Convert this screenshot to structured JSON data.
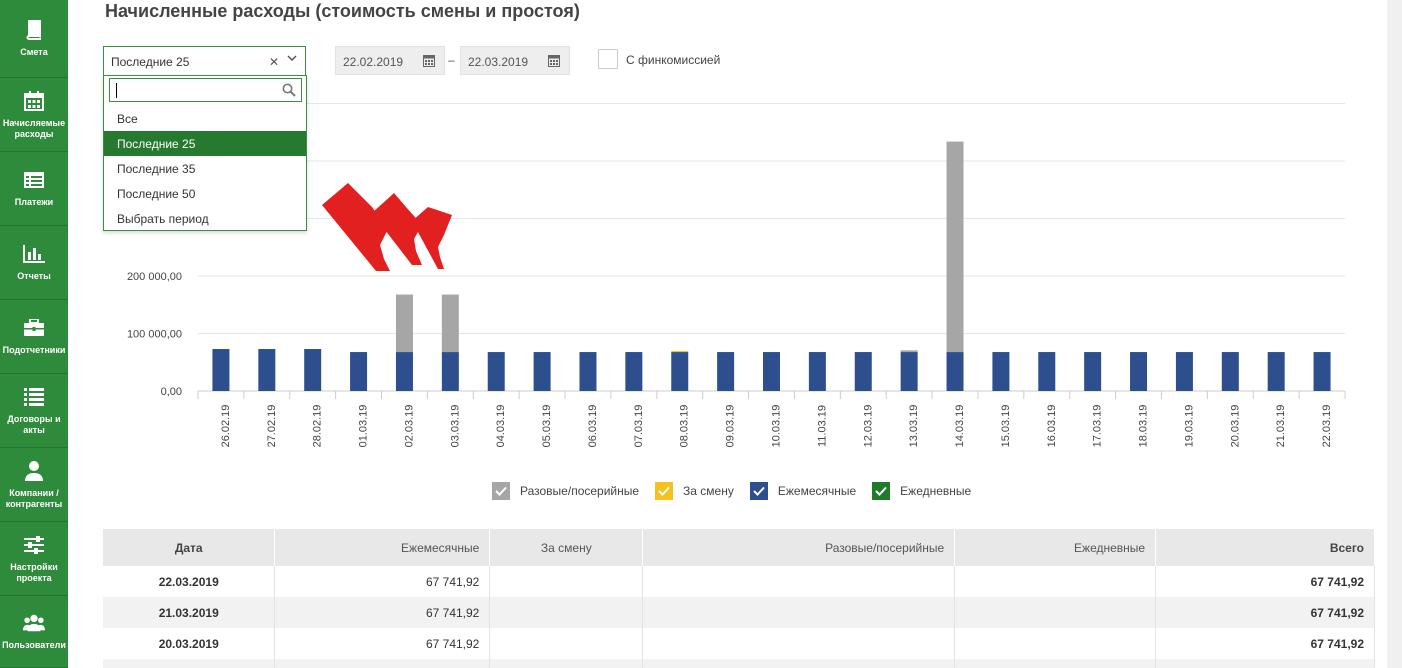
{
  "sidebar": {
    "items": [
      {
        "label": "Смета",
        "icon": "book-icon"
      },
      {
        "label": "Начисляемые расходы",
        "icon": "calendar-icon"
      },
      {
        "label": "Платежи",
        "icon": "list-icon"
      },
      {
        "label": "Отчеты",
        "icon": "bar-chart-icon"
      },
      {
        "label": "Подотчетники",
        "icon": "briefcase-icon"
      },
      {
        "label": "Договоры и акты",
        "icon": "list-lines-icon"
      },
      {
        "label": "Компании / контрагенты",
        "icon": "user-icon"
      },
      {
        "label": "Настройки проекта",
        "icon": "sliders-icon"
      },
      {
        "label": "Пользователи",
        "icon": "users-icon"
      }
    ]
  },
  "page": {
    "title": "Начисленные расходы (стоимость смены и простоя)"
  },
  "filters": {
    "period_value": "Последние 25",
    "search_value": "",
    "options": [
      "Все",
      "Последние 25",
      "Последние 35",
      "Последние 50",
      "Выбрать период"
    ],
    "selected_index": 1,
    "date_from": "22.02.2019",
    "date_to": "22.03.2019",
    "date_separator": "–",
    "fincommission_label": "С финкомиссией",
    "fincommission_checked": false
  },
  "chart_data": {
    "type": "bar",
    "stacked": true,
    "categories": [
      "26.02.19",
      "27.02.19",
      "28.02.19",
      "01.03.19",
      "02.03.19",
      "03.03.19",
      "04.03.19",
      "05.03.19",
      "06.03.19",
      "07.03.19",
      "08.03.19",
      "09.03.19",
      "10.03.19",
      "11.03.19",
      "12.03.19",
      "13.03.19",
      "14.03.19",
      "15.03.19",
      "16.03.19",
      "17.03.19",
      "18.03.19",
      "19.03.19",
      "20.03.19",
      "21.03.19",
      "22.03.19"
    ],
    "series": [
      {
        "name": "Ежемесячные",
        "color": "#2d4f8e",
        "values": [
          73000,
          73000,
          73000,
          67741.92,
          67741.92,
          67741.92,
          67741.92,
          67741.92,
          67741.92,
          67741.92,
          67741.92,
          67741.92,
          67741.92,
          67741.92,
          67741.92,
          67741.92,
          67741.92,
          67741.92,
          67741.92,
          67741.92,
          67741.92,
          67741.92,
          67741.92,
          67741.92,
          67741.92
        ]
      },
      {
        "name": "За смену",
        "color": "#f5c11f",
        "values": [
          0,
          0,
          0,
          0,
          0,
          0,
          0,
          0,
          0,
          0,
          1800,
          0,
          0,
          0,
          0,
          0,
          0,
          0,
          0,
          0,
          0,
          0,
          0,
          0,
          0
        ]
      },
      {
        "name": "Разовые/посерийные",
        "color": "#a6a6a6",
        "values": [
          0,
          0,
          0,
          0,
          100000,
          100000,
          0,
          0,
          0,
          0,
          0,
          0,
          0,
          0,
          0,
          3000,
          366000,
          0,
          0,
          0,
          0,
          0,
          0,
          0,
          0
        ]
      },
      {
        "name": "Ежедневные",
        "color": "#1f7a2a",
        "values": [
          0,
          0,
          0,
          0,
          0,
          0,
          0,
          0,
          0,
          0,
          0,
          0,
          0,
          0,
          0,
          0,
          0,
          0,
          0,
          0,
          0,
          0,
          0,
          0,
          0
        ]
      }
    ],
    "y_ticks": [
      "0,00",
      "100 000,00",
      "200 000,00"
    ],
    "ylim": [
      0,
      500000
    ],
    "grid": true,
    "legend_position": "bottom"
  },
  "legend": [
    {
      "label": "Разовые/посерийные",
      "color": "#a6a6a6",
      "checked": true
    },
    {
      "label": "За смену",
      "color": "#f5c11f",
      "checked": true
    },
    {
      "label": "Ежемесячные",
      "color": "#2d4f8e",
      "checked": true
    },
    {
      "label": "Ежедневные",
      "color": "#1f7a2a",
      "checked": true
    }
  ],
  "table": {
    "headers": [
      "Дата",
      "Ежемесячные",
      "За смену",
      "Разовые/посерийные",
      "Ежедневные",
      "Всего"
    ],
    "rows": [
      {
        "date": "22.03.2019",
        "monthly": "67 741,92",
        "shift": "",
        "oneoff": "",
        "daily": "",
        "total": "67 741,92"
      },
      {
        "date": "21.03.2019",
        "monthly": "67 741,92",
        "shift": "",
        "oneoff": "",
        "daily": "",
        "total": "67 741,92"
      },
      {
        "date": "20.03.2019",
        "monthly": "67 741,92",
        "shift": "",
        "oneoff": "",
        "daily": "",
        "total": "67 741,92"
      },
      {
        "date": "",
        "monthly": "",
        "shift": "",
        "oneoff": "",
        "daily": "",
        "total": ""
      }
    ]
  }
}
